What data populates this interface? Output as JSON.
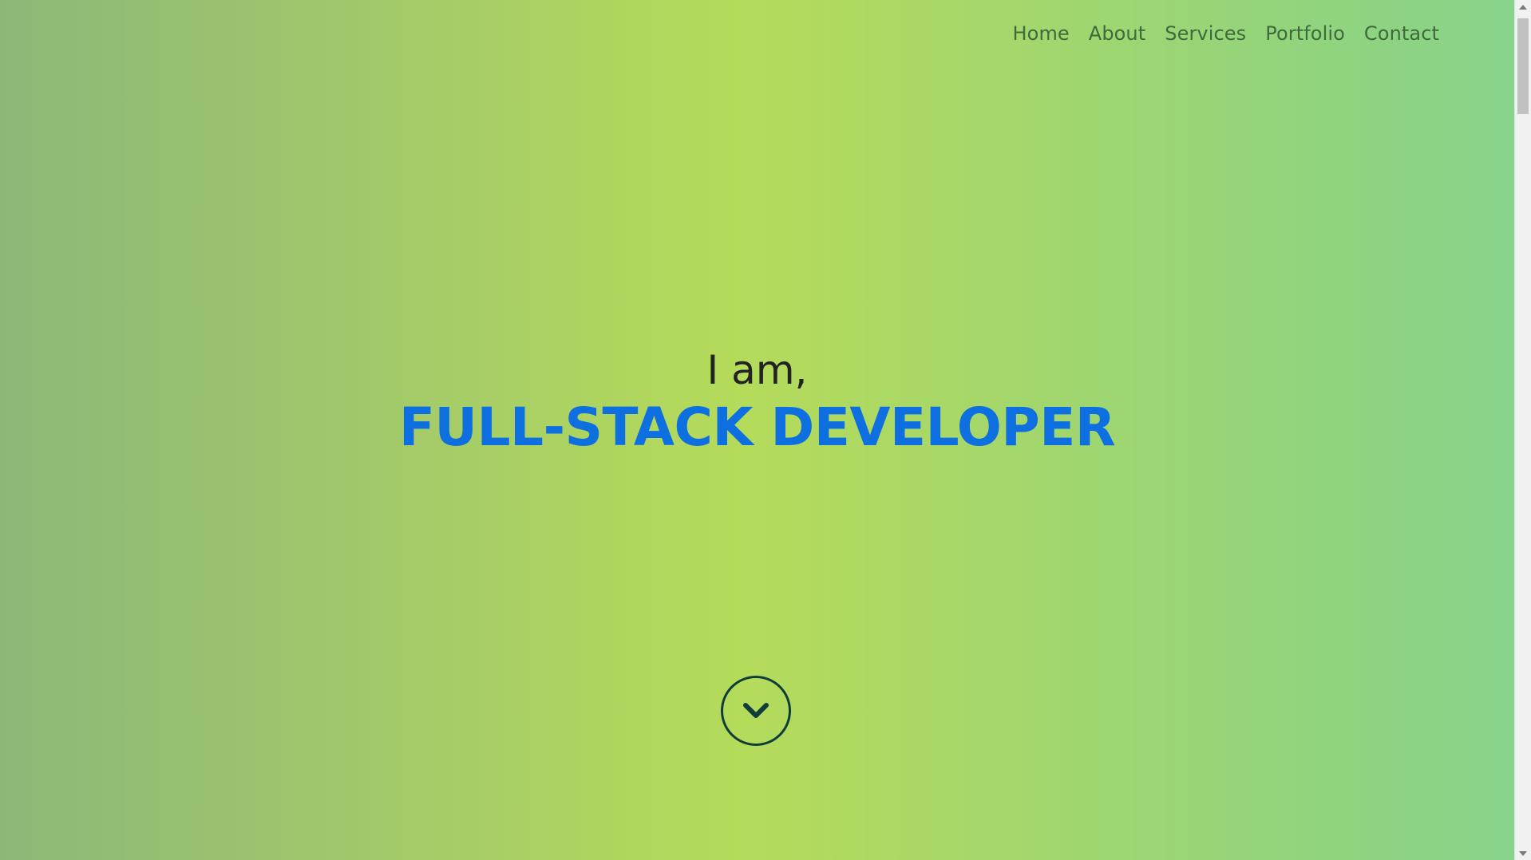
{
  "nav": {
    "items": [
      {
        "label": "Home"
      },
      {
        "label": "About"
      },
      {
        "label": "Services"
      },
      {
        "label": "Portfolio"
      },
      {
        "label": "Contact"
      }
    ]
  },
  "hero": {
    "pre_title": "I am,",
    "title": "FULL-STACK DEVELOPER"
  },
  "scroll_button": {
    "icon": "chevron-down-icon"
  },
  "colors": {
    "title_accent": "#0e6fe0",
    "nav_text": "#3e6b3a",
    "gradient_center": "#b5db5a",
    "gradient_edges": "#8bb878"
  }
}
